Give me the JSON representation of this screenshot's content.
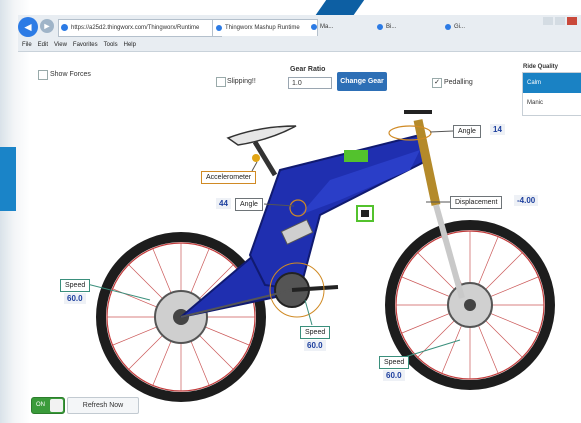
{
  "browser": {
    "address": "https://a25d2.thingworx.com/Thingworx/Runtime",
    "tabs": [
      {
        "label": "Thingworx Mashup Runtime"
      },
      {
        "label": "Ma..."
      },
      {
        "label": "Bi..."
      },
      {
        "label": "Gi..."
      }
    ],
    "menu": [
      "File",
      "Edit",
      "View",
      "Favorites",
      "Tools",
      "Help"
    ]
  },
  "controls": {
    "show_forces_label": "Show Forces",
    "slipping_label": "Slipping!!",
    "gear_ratio_label": "Gear Ratio",
    "gear_ratio_value": "1.0",
    "change_gear_label": "Change Gear",
    "pedalling_label": "Pedalling",
    "pedalling_checked": "✓"
  },
  "ride_quality": {
    "title": "Ride Quality",
    "options": [
      "Calm",
      "Manic"
    ],
    "selected": "Calm"
  },
  "readouts": {
    "head_angle": {
      "label": "Angle",
      "value": "14"
    },
    "accelerometer": {
      "label": "Accelerometer"
    },
    "frame_angle": {
      "label": "Angle",
      "value": "44"
    },
    "displacement": {
      "label": "Displacement",
      "value": "-4.00"
    },
    "rear_speed": {
      "label": "Speed",
      "value": "60.0"
    },
    "crank_speed": {
      "label": "Speed",
      "value": "60.0"
    },
    "front_speed": {
      "label": "Speed",
      "value": "60.0"
    }
  },
  "footer": {
    "toggle_label": "ON",
    "refresh_label": "Refresh Now"
  },
  "colors": {
    "frame": "#1f2fb0",
    "fork": "#b48a2a",
    "accent_blue": "#1a82c4",
    "button_blue": "#2d6fb6",
    "toggle_green": "#3a9b3a"
  }
}
